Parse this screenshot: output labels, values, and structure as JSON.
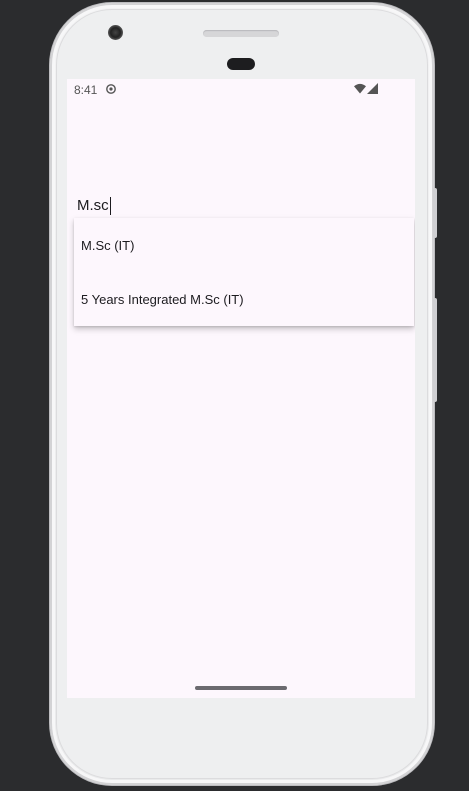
{
  "status_bar": {
    "time": "8:41",
    "app_icon": "debug-notification-icon",
    "wifi_icon": "wifi-icon",
    "signal_icon": "cell-signal-icon"
  },
  "search": {
    "value": "M.sc",
    "placeholder": ""
  },
  "suggestions": [
    {
      "label": "M.Sc (IT)"
    },
    {
      "label": "5 Years Integrated M.Sc (IT)"
    }
  ],
  "colors": {
    "screen_background": "#fdf7fd",
    "text": "#1c1b1f",
    "underline": "#3a3a3a"
  }
}
